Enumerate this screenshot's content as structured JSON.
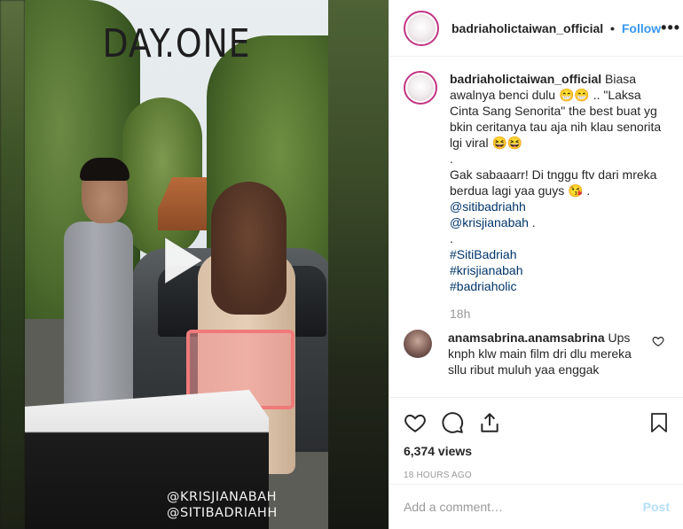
{
  "media": {
    "overlay_title": "DAY.ONE",
    "tag_line_1": "@KRISJIANABAH",
    "tag_line_2": "@SITIBADRIAHH"
  },
  "header": {
    "username": "badriaholictaiwan_official",
    "separator": "•",
    "follow_label": "Follow",
    "more_label": "•••"
  },
  "caption": {
    "username": "badriaholictaiwan_official",
    "text_1": "Biasa awalnya benci dulu 😁😁 .. \"Laksa Cinta Sang Senorita\" the best buat yg bkin ceritanya tau aja nih klau senorita lgi viral 😆😆",
    "dot_1": ".",
    "text_2": "Gak sabaaarr! Di tnggu ftv dari mreka berdua lagi yaa guys 😘 .",
    "mention_1": "@sitibadriahh",
    "mention_2": "@krisjianabah",
    "mention_2_suffix": " .",
    "dot_2": ".",
    "hashtag_1": "#SitiBadriah",
    "hashtag_2": "#krisjianabah",
    "hashtag_3": "#badriaholic",
    "time": "18h"
  },
  "comment": {
    "username": "anamsabrina.anamsabrina",
    "text": "Ups knph klw main film dri dlu mereka sllu ribut muluh yaa enggak"
  },
  "stats": {
    "views": "6,374 views",
    "posted_ago": "18 HOURS AGO"
  },
  "add_comment": {
    "placeholder": "Add a comment…",
    "post_label": "Post"
  },
  "colors": {
    "follow": "#3897f0",
    "post_disabled": "#b2dffc",
    "link": "#003569"
  }
}
